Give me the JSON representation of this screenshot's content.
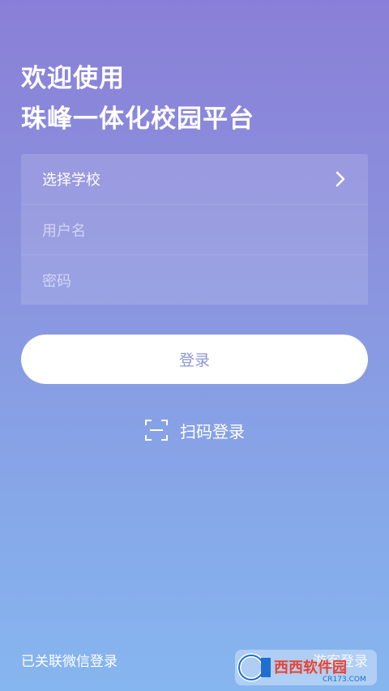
{
  "welcome": {
    "line1": "欢迎使用",
    "line2": "珠峰一体化校园平台"
  },
  "form": {
    "school_label": "选择学校",
    "username_placeholder": "用户名",
    "password_placeholder": "密码"
  },
  "login_button": "登录",
  "scan_login": "扫码登录",
  "footer": {
    "wechat_login": "已关联微信登录",
    "tourist_entry": "游客登录"
  },
  "watermark": {
    "brand": "西西软件园",
    "site": "CR173.COM"
  },
  "colors": {
    "bg_top": "#8a7fd8",
    "bg_bottom": "#86b6ef",
    "button_text": "#8f95d6"
  },
  "icons": {
    "chevron": "chevron-right-icon",
    "scan": "scan-frame-icon"
  }
}
